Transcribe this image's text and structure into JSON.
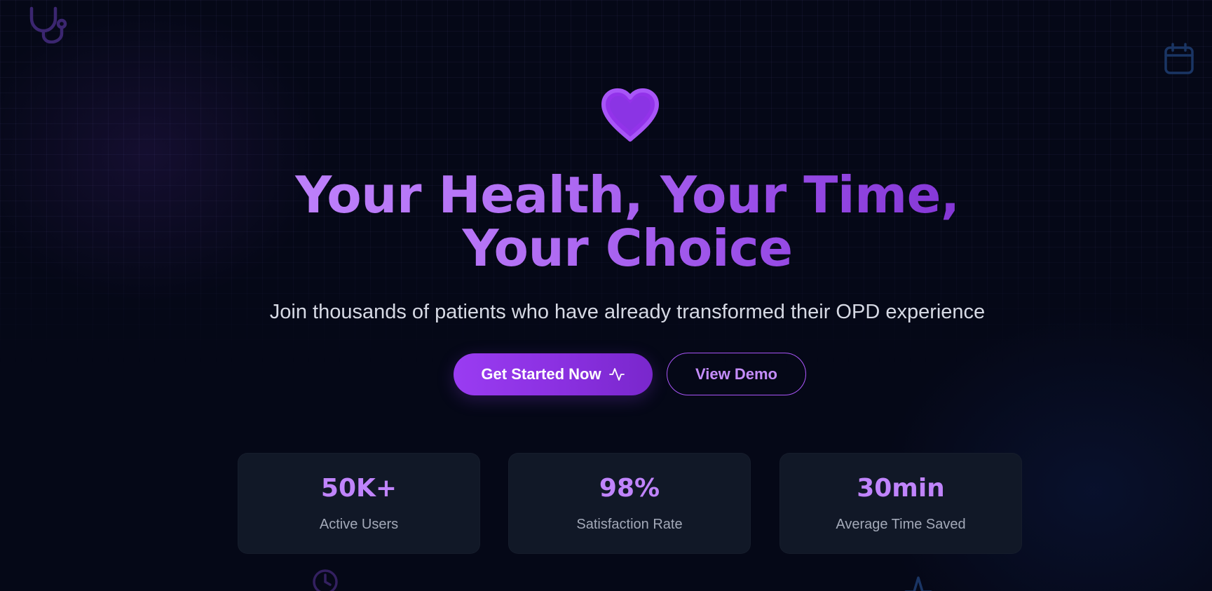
{
  "hero": {
    "heart_icon": "heart-icon",
    "headline": "Your Health, Your Time, Your Choice",
    "subtitle": "Join thousands of patients who have already transformed their OPD experience",
    "primary_button": {
      "label": "Get Started Now",
      "icon": "activity-pulse-icon"
    },
    "secondary_button": {
      "label": "View Demo"
    }
  },
  "stats": [
    {
      "value": "50K+",
      "label": "Active Users"
    },
    {
      "value": "98%",
      "label": "Satisfaction Rate"
    },
    {
      "value": "30min",
      "label": "Average Time Saved"
    }
  ],
  "decorations": {
    "top_left": "stethoscope-icon",
    "top_right": "calendar-icon",
    "bottom_left": "clock-icon",
    "bottom_right": "pulse-icon"
  },
  "colors": {
    "background": "#050817",
    "accent": "#a855f7",
    "headline_gradient_start": "#c084fc",
    "headline_gradient_end": "#7e2fd0",
    "card_background": "#111827",
    "stat_value": "#c084fc",
    "stat_label": "#a3a9b8",
    "subtitle": "#d6d9e4"
  }
}
